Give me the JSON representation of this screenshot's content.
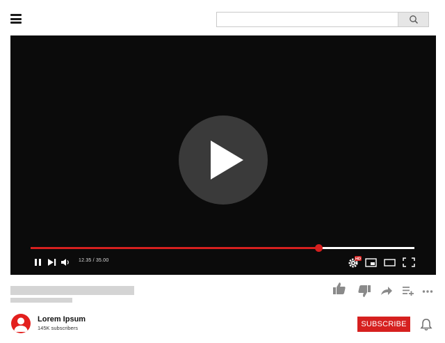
{
  "search": {
    "value": "",
    "placeholder": ""
  },
  "player": {
    "time_display": "12.35 / 35.00",
    "progress_fraction": 0.75,
    "hd_badge": "HD"
  },
  "channel": {
    "name": "Lorem Ipsum",
    "subscribers": "145K  subscribers"
  },
  "actions": {
    "subscribe_label": "SUBSCRIBE"
  },
  "colors": {
    "accent": "#d6201f",
    "player_bg": "#0b0b0b",
    "placeholder_bar": "#d4d4d4"
  }
}
